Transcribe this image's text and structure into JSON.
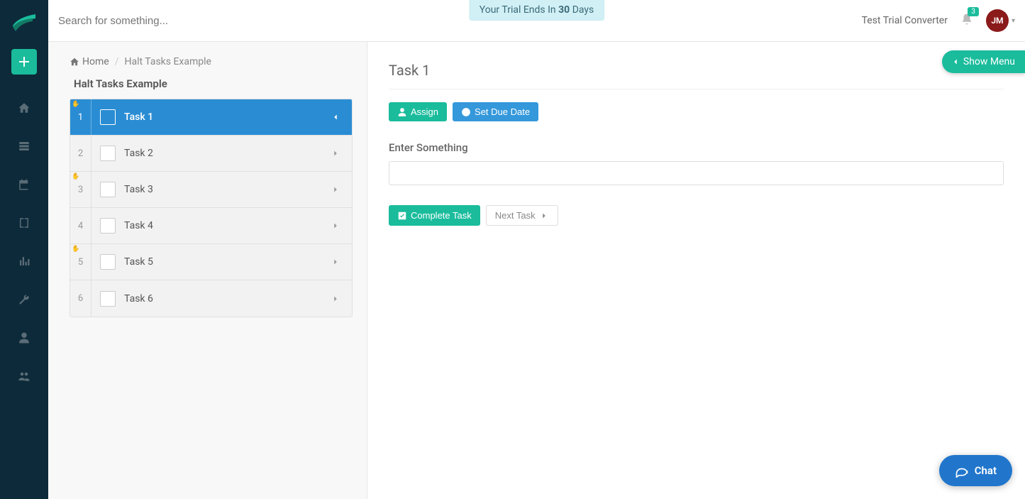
{
  "header": {
    "search_placeholder": "Search for something...",
    "trial_banner_prefix": "Your Trial Ends In ",
    "trial_banner_days": "30",
    "trial_banner_suffix": " Days",
    "account_label": "Test Trial Converter",
    "notification_count": "3",
    "avatar_initials": "JM"
  },
  "breadcrumb": {
    "home": "Home",
    "current": "Halt Tasks Example"
  },
  "panel": {
    "title": "Halt Tasks Example"
  },
  "tasks": [
    {
      "num": "1",
      "label": "Task 1",
      "active": true,
      "halt": true
    },
    {
      "num": "2",
      "label": "Task 2",
      "active": false,
      "halt": false
    },
    {
      "num": "3",
      "label": "Task 3",
      "active": false,
      "halt": true
    },
    {
      "num": "4",
      "label": "Task 4",
      "active": false,
      "halt": false
    },
    {
      "num": "5",
      "label": "Task 5",
      "active": false,
      "halt": true
    },
    {
      "num": "6",
      "label": "Task 6",
      "active": false,
      "halt": false
    }
  ],
  "detail": {
    "title": "Task 1",
    "assign_label": "Assign",
    "set_due_label": "Set Due Date",
    "form_label": "Enter Something",
    "input_value": "",
    "complete_label": "Complete Task",
    "next_label": "Next Task"
  },
  "show_menu_label": "Show Menu",
  "chat_label": "Chat"
}
